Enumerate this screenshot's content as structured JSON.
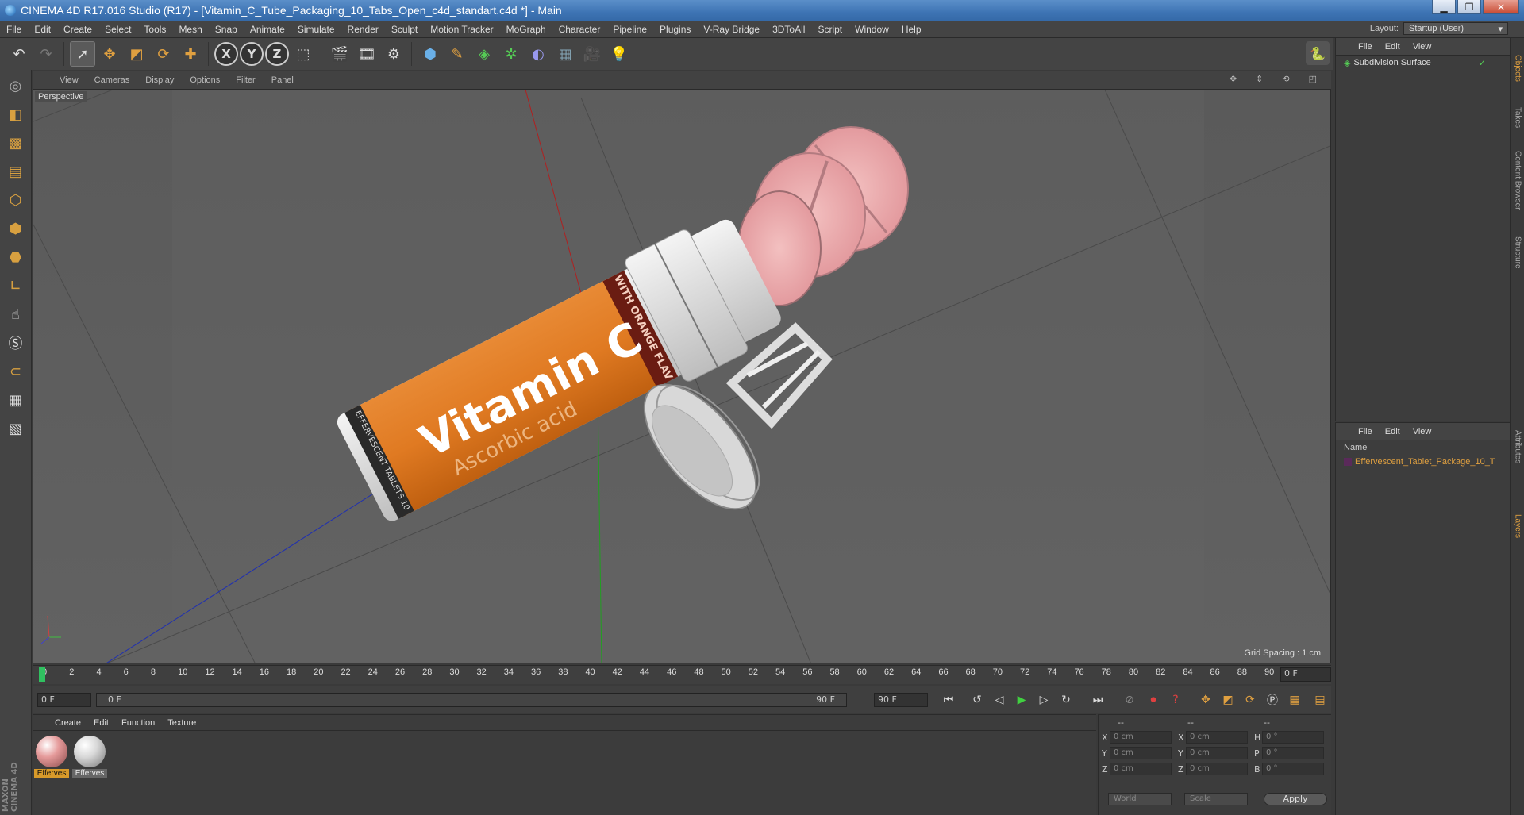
{
  "window": {
    "title": "CINEMA 4D R17.016 Studio (R17) - [Vitamin_C_Tube_Packaging_10_Tabs_Open_c4d_standart.c4d *] - Main"
  },
  "menubar": [
    "File",
    "Edit",
    "Create",
    "Select",
    "Tools",
    "Mesh",
    "Snap",
    "Animate",
    "Simulate",
    "Render",
    "Sculpt",
    "Motion Tracker",
    "MoGraph",
    "Character",
    "Pipeline",
    "Plugins",
    "V-Ray Bridge",
    "3DToAll",
    "Script",
    "Window",
    "Help"
  ],
  "layout": {
    "label": "Layout:",
    "value": "Startup (User)"
  },
  "viewport": {
    "menu": [
      "View",
      "Cameras",
      "Display",
      "Options",
      "Filter",
      "Panel"
    ],
    "label": "Perspective",
    "grid_spacing": "Grid Spacing : 1 cm",
    "product": {
      "main_text": "Vitamin C",
      "sub_text": "Ascorbic acid",
      "band_text": "WITH ORANGE FLAV",
      "rim_text": "EFFERVESCENT TABLETS 10"
    }
  },
  "timeline": {
    "ticks": [
      "0",
      "2",
      "4",
      "6",
      "8",
      "10",
      "12",
      "14",
      "16",
      "18",
      "20",
      "22",
      "24",
      "26",
      "28",
      "30",
      "32",
      "34",
      "36",
      "38",
      "40",
      "42",
      "44",
      "46",
      "48",
      "50",
      "52",
      "54",
      "56",
      "58",
      "60",
      "62",
      "64",
      "66",
      "68",
      "70",
      "72",
      "74",
      "76",
      "78",
      "80",
      "82",
      "84",
      "86",
      "88",
      "90"
    ],
    "current": "0 F"
  },
  "transport": {
    "start": "0 F",
    "range_start": "0 F",
    "range_end": "90 F",
    "end": "90 F"
  },
  "materials": {
    "menu": [
      "Create",
      "Edit",
      "Function",
      "Texture"
    ],
    "items": [
      {
        "label": "Efferves",
        "color": "#e59a9a"
      },
      {
        "label": "Efferves",
        "color": "#d8d8d8"
      }
    ]
  },
  "coordinates": {
    "dashes": [
      "--",
      "--",
      "--"
    ],
    "rows": [
      {
        "a_label": "X",
        "a_val": "0 cm",
        "b_label": "X",
        "b_val": "0 cm",
        "c_label": "H",
        "c_val": "0 °"
      },
      {
        "a_label": "Y",
        "a_val": "0 cm",
        "b_label": "Y",
        "b_val": "0 cm",
        "c_label": "P",
        "c_val": "0 °"
      },
      {
        "a_label": "Z",
        "a_val": "0 cm",
        "b_label": "Z",
        "b_val": "0 cm",
        "c_label": "B",
        "c_val": "0 °"
      }
    ],
    "mode": "World",
    "scale": "Scale",
    "apply": "Apply"
  },
  "objects": {
    "menu": [
      "File",
      "Edit",
      "View"
    ],
    "items": [
      {
        "name": "Subdivision Surface"
      }
    ]
  },
  "layers": {
    "menu": [
      "File",
      "Edit",
      "View"
    ],
    "column": "Name",
    "items": [
      {
        "name": "Effervescent_Tablet_Package_10_T"
      }
    ]
  },
  "right_tabs": [
    "Objects",
    "Takes",
    "Content Browser",
    "Structure",
    "Attributes",
    "Layers"
  ],
  "branding": "MAXON CINEMA 4D",
  "colors": {
    "accent": "#e0a040",
    "label_orange": "#e07a22"
  }
}
